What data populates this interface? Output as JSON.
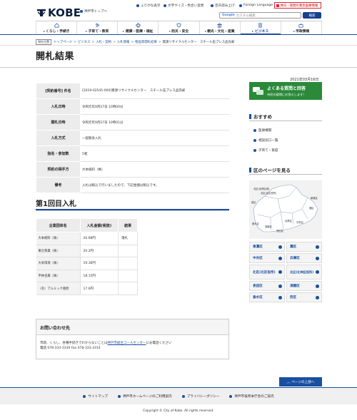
{
  "header": {
    "logo_text": "KOBE",
    "home_link": "神戸市トップへ",
    "util_links": [
      "ふりがな表示",
      "文字サイズ・色合い変更",
      "音声読み上げ",
      "Foreign Language"
    ],
    "emergency": "休日・夜間の救急医療情報",
    "search_placeholder": "カスタム検索",
    "search_brand": "Google",
    "search_button": "検索"
  },
  "gnav": [
    {
      "label": "くらし・手続き",
      "icon": "house-icon"
    },
    {
      "label": "子育て・教育",
      "icon": "family-icon"
    },
    {
      "label": "健康・医療・福祉",
      "icon": "health-icon"
    },
    {
      "label": "防災・安全",
      "icon": "shield-icon"
    },
    {
      "label": "観光・文化・産業",
      "icon": "culture-icon"
    },
    {
      "label": "ビジネス",
      "icon": "building-icon"
    },
    {
      "label": "市政情報",
      "icon": "cityhall-icon"
    }
  ],
  "breadcrumb": {
    "here": "現在位置",
    "items": [
      "トップページ",
      "ビジネス",
      "入札・契約",
      "入札情報",
      "物品等開札結果"
    ],
    "current": "資源リサイクルセンター　スチール缶プレス品売却"
  },
  "page_title": "開札結果",
  "date": "2021年03月16日",
  "info_rows": [
    {
      "label": "[契約番号] 件名",
      "value": "[2019-02545-000]資源リサイクルセンター　スチール缶プレス品売却"
    },
    {
      "label": "入札日時",
      "value": "令和元年9月27日 10時00分"
    },
    {
      "label": "開札日時",
      "value": "令和元年9月27日 10時01分"
    },
    {
      "label": "入札方式",
      "value": "一般競争入札"
    },
    {
      "label": "指名・参加数",
      "value": "5者"
    },
    {
      "label": "契約の相手方",
      "value": "大本紙料（株）"
    },
    {
      "label": "備考",
      "value": "入札は税込で行いましたので、下記金額は税込です。"
    }
  ],
  "round_heading": "第1回目入札",
  "bid_table": {
    "headers": [
      "企業団体名",
      "入札金額(税抜)",
      "結果"
    ],
    "rows": [
      {
        "company": "大本紙料（株）",
        "amount": "20.68円",
        "result": "落札"
      },
      {
        "company": "東企興業（株）",
        "amount": "20.2円",
        "result": ""
      },
      {
        "company": "大栄環境（株）",
        "amount": "19.36円",
        "result": ""
      },
      {
        "company": "平林金属（株）",
        "amount": "18.15円",
        "result": ""
      },
      {
        "company": "（有）アルミック徳原",
        "amount": "17.6円",
        "result": ""
      }
    ]
  },
  "inquiry": {
    "heading": "お問い合わせ先",
    "line1_pre": "市政、くらし、各種手続きでわからないことは",
    "line1_link": "神戸市総合コールセンター",
    "line1_post": "にお電話ください",
    "line2": "電話 078-333-3330 Fax 078-333-3314"
  },
  "sidebar": {
    "faq_title": "よくある質問と回答",
    "faq_sub": "市民の疑問にお答えします！",
    "recommend_heading": "おすすめ",
    "recommend": [
      "医療機関",
      "相談窓口一覧",
      "子育て・家庭"
    ],
    "ward_heading": "区のページを見る",
    "map_labels": [
      "北区(北神区域)",
      "北区(北区役所)",
      "西区",
      "須磨区",
      "垂水区",
      "長田区",
      "兵庫区",
      "中央区",
      "灘区",
      "東灘区"
    ],
    "wards": [
      "東灘区",
      "灘区",
      "中央区",
      "兵庫区",
      "北区(北区役所)",
      "北区(北神区役所)",
      "長田区",
      "須磨区",
      "垂水区",
      "西区"
    ]
  },
  "pagetop": "ページの上部へ",
  "footer_links": [
    "サイトマップ",
    "神戸市ホームページのご利用案内",
    "プライバシーポリシー",
    "神戸市役所本庁舎のご案内"
  ],
  "copyright": "Copyright © City of Kobe. All rights reserved."
}
